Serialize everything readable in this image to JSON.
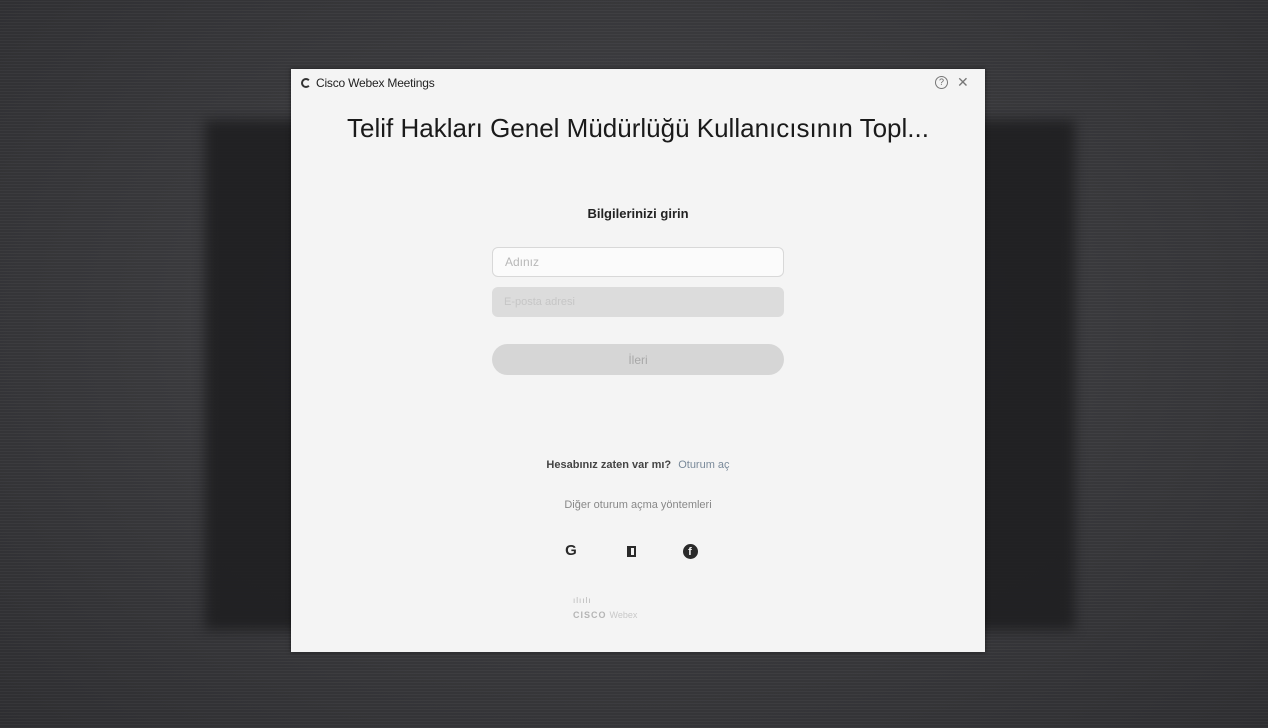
{
  "window": {
    "app_title": "Cisco Webex Meetings",
    "help_icon": "?",
    "close_icon": "✕"
  },
  "meeting": {
    "title": "Telif Hakları Genel Müdürlüğü Kullanıcısının Topl..."
  },
  "form": {
    "heading": "Bilgilerinizi girin",
    "name_placeholder": "Adınız",
    "email_placeholder": "E-posta adresi",
    "next_label": "İleri"
  },
  "account": {
    "question": "Hesabınız zaten var mı?",
    "signin_link": "Oturum aç"
  },
  "other_methods": {
    "label": "Diğer oturum açma yöntemleri",
    "providers": [
      "google-icon",
      "office-icon",
      "facebook-icon"
    ],
    "google_glyph": "G",
    "facebook_glyph": "f"
  },
  "brand": {
    "cisco_bars": "ılıılı",
    "cisco_word": "CISCO",
    "webex_word": "Webex"
  }
}
